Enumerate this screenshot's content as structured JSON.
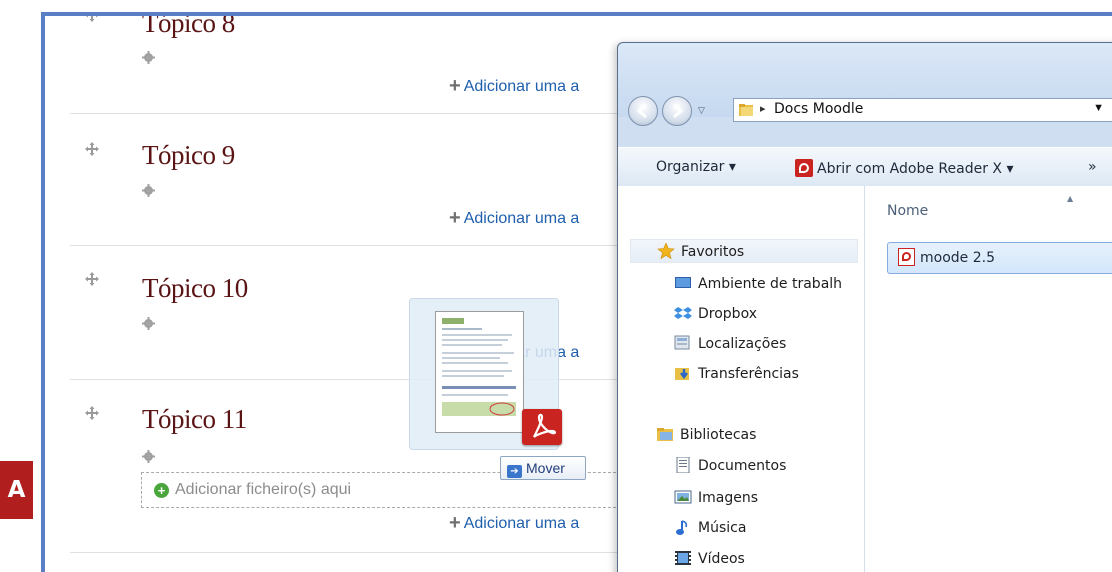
{
  "side_label": "A",
  "course": {
    "sections": [
      {
        "title": "Tópico 8",
        "add_activity": "Adicionar uma a"
      },
      {
        "title": "Tópico 9",
        "add_activity": "Adicionar uma a"
      },
      {
        "title": "Tópico 10",
        "add_activity": "Adicionar uma a"
      },
      {
        "title": "Tópico 11",
        "add_activity": "Adicionar uma a"
      }
    ],
    "dropzone_text": "Adicionar ficheiro(s) aqui"
  },
  "drag": {
    "tooltip": "Mover"
  },
  "explorer": {
    "address": "Docs Moodle",
    "commands": {
      "organize": "Organizar ▾",
      "open_with": "Abrir com Adobe Reader X ▾",
      "more": "»"
    },
    "nav": {
      "favorites": "Favoritos",
      "favorites_items": [
        "Ambiente de trabalh",
        "Dropbox",
        "Localizações",
        "Transferências"
      ],
      "libraries": "Bibliotecas",
      "libraries_items": [
        "Documentos",
        "Imagens",
        "Música",
        "Vídeos"
      ]
    },
    "column_name": "Nome",
    "files": [
      "moode 2.5"
    ]
  },
  "colors": {
    "frame_border": "#5b7fc4",
    "topic_title": "#5a1414",
    "link": "#1f5fad",
    "label_bg": "#b01e1e"
  }
}
